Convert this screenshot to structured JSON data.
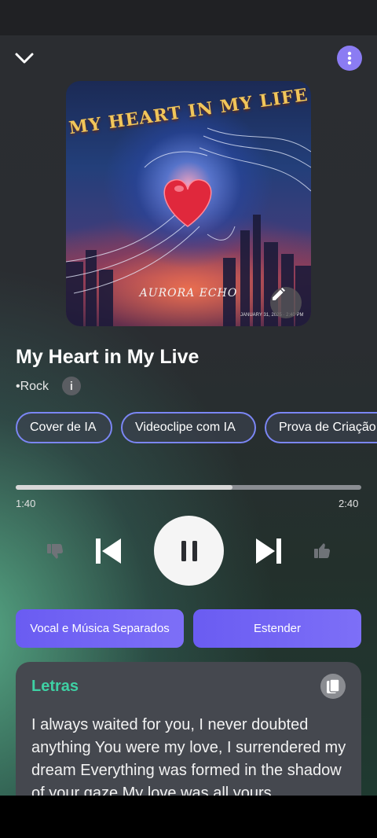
{
  "header": {
    "collapse_icon": "chevron-down-icon",
    "menu_icon": "more-vertical-icon"
  },
  "cover": {
    "title_art": "MY HEART IN MY LIFE",
    "artist_art": "AURORA ECHO",
    "date_art": "JANUARY 31, 2025 · 2:40 PM",
    "edit_icon": "pencil-icon"
  },
  "song": {
    "title": "My Heart in My Live",
    "genre": "•Rock",
    "info_label": "i"
  },
  "chips": [
    {
      "label": "Cover de IA"
    },
    {
      "label": "Videoclipe com IA"
    },
    {
      "label": "Prova de Criação"
    }
  ],
  "player": {
    "current_time": "1:40",
    "total_time": "2:40",
    "progress": 0.627,
    "controls": [
      "thumbs-down-icon",
      "skip-previous-icon",
      "pause-icon",
      "skip-next-icon",
      "thumbs-up-icon"
    ]
  },
  "actions": {
    "separate_label": "Vocal e Música Separados",
    "extend_label": "Estender"
  },
  "lyrics": {
    "heading": "Letras",
    "copy_icon": "copy-icon",
    "text": "I always waited for you, I never doubted anything You were my love, I surrendered my dream Everything was formed in the shadow of your gaze My love was all yours"
  },
  "colors": {
    "accent": "#7b6cf6",
    "lyrics_heading": "#3ed1a4",
    "chip_border": "#7b86f4"
  }
}
